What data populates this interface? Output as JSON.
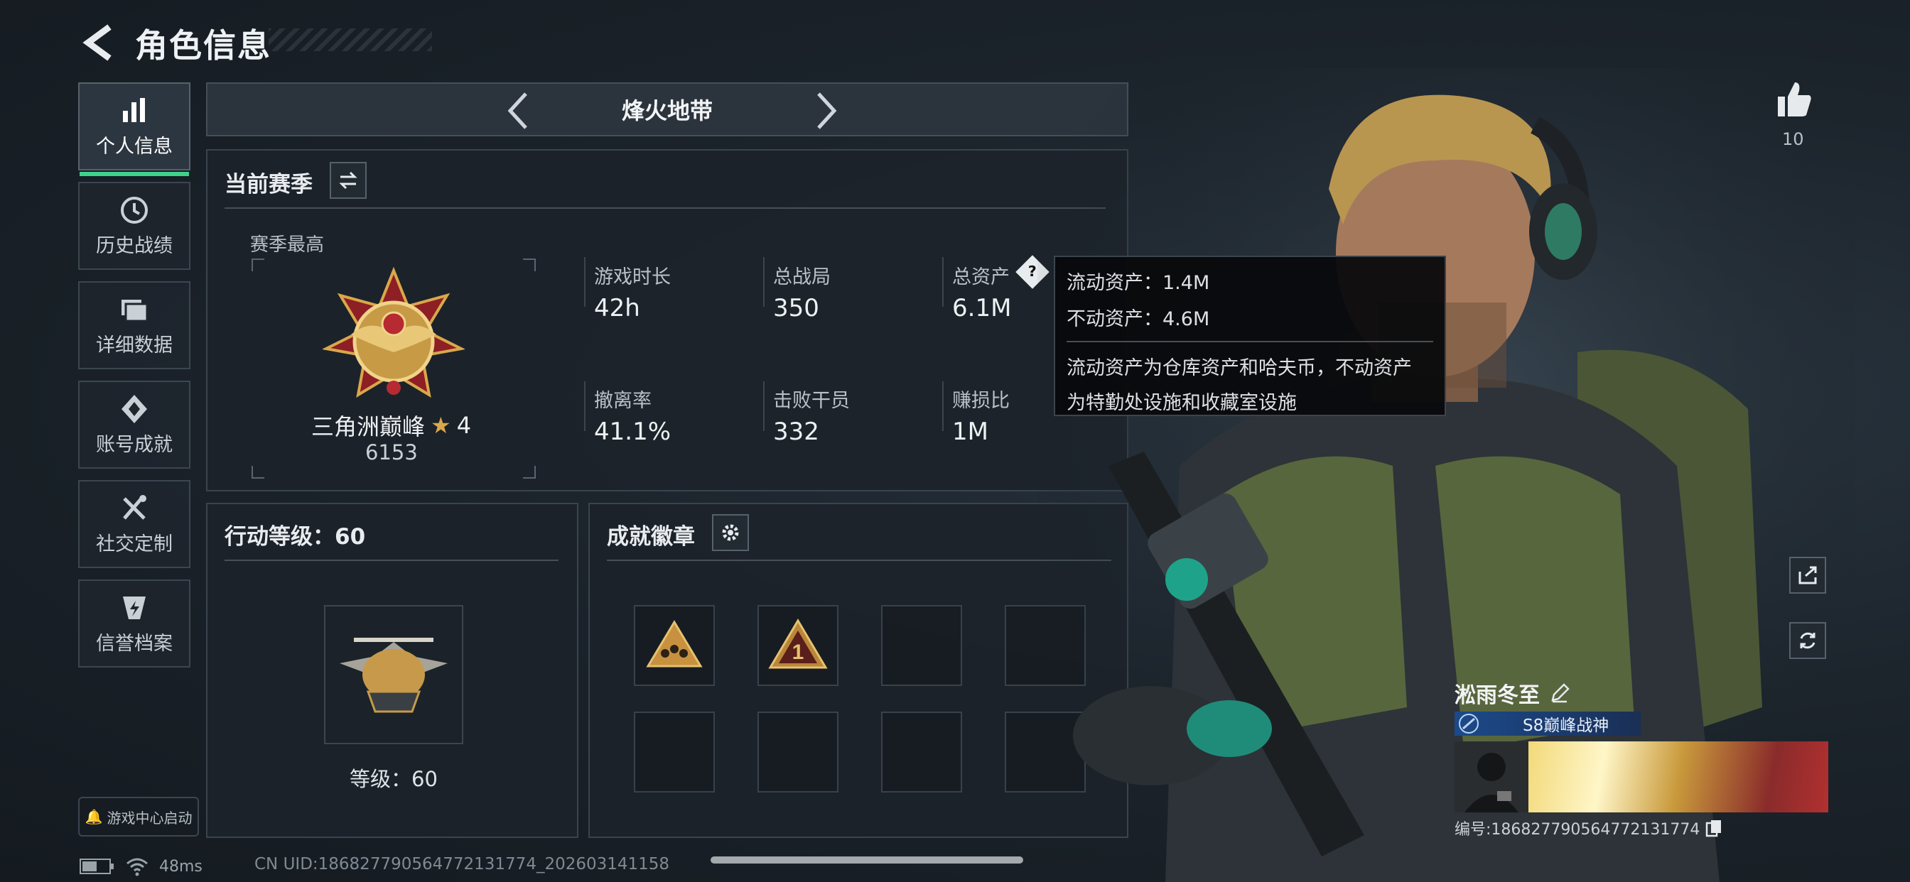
{
  "header": {
    "title": "角色信息",
    "back_icon": "back-arrow-icon"
  },
  "sidebar": {
    "items": [
      {
        "label": "个人信息",
        "icon": "bar-chart-icon",
        "active": true
      },
      {
        "label": "历史战绩",
        "icon": "history-clock-icon",
        "active": false
      },
      {
        "label": "详细数据",
        "icon": "folder-icon",
        "active": false
      },
      {
        "label": "账号成就",
        "icon": "achievement-icon",
        "active": false
      },
      {
        "label": "社交定制",
        "icon": "tools-icon",
        "active": false
      },
      {
        "label": "信誉档案",
        "icon": "credit-shield-icon",
        "active": false
      }
    ],
    "launcher_label": "游戏中心启动"
  },
  "mode": {
    "title": "烽火地带"
  },
  "season": {
    "title": "当前赛季",
    "best_label": "赛季最高",
    "rank_name": "三角洲巅峰",
    "rank_stars": "4",
    "rank_points": "6153",
    "stats": [
      {
        "label": "游戏时长",
        "value": "42h"
      },
      {
        "label": "总战局",
        "value": "350"
      },
      {
        "label": "总资产",
        "value": "6.1M"
      },
      {
        "label": "撤离率",
        "value": "41.1%"
      },
      {
        "label": "击败干员",
        "value": "332"
      },
      {
        "label": "赚损比",
        "value": "1M"
      }
    ]
  },
  "tooltip": {
    "line1": "流动资产：1.4M",
    "line2": "不动资产：4.6M",
    "desc1": "流动资产为仓库资产和哈夫币，不动资产",
    "desc2": "为特勤处设施和收藏室设施"
  },
  "level": {
    "title": "行动等级：60",
    "label": "等级：60"
  },
  "badges": {
    "title": "成就徽章"
  },
  "likes": {
    "count": "10"
  },
  "profile": {
    "name": "淞雨冬至",
    "title": "S8巅峰战神",
    "id_line": "编号:1868277905647721317​74"
  },
  "status": {
    "ping": "48ms",
    "uid": "CN UID:18682779056477213177​4_202603141158"
  },
  "colors": {
    "accent": "#3fd28a",
    "gold": "#d9a84a"
  }
}
